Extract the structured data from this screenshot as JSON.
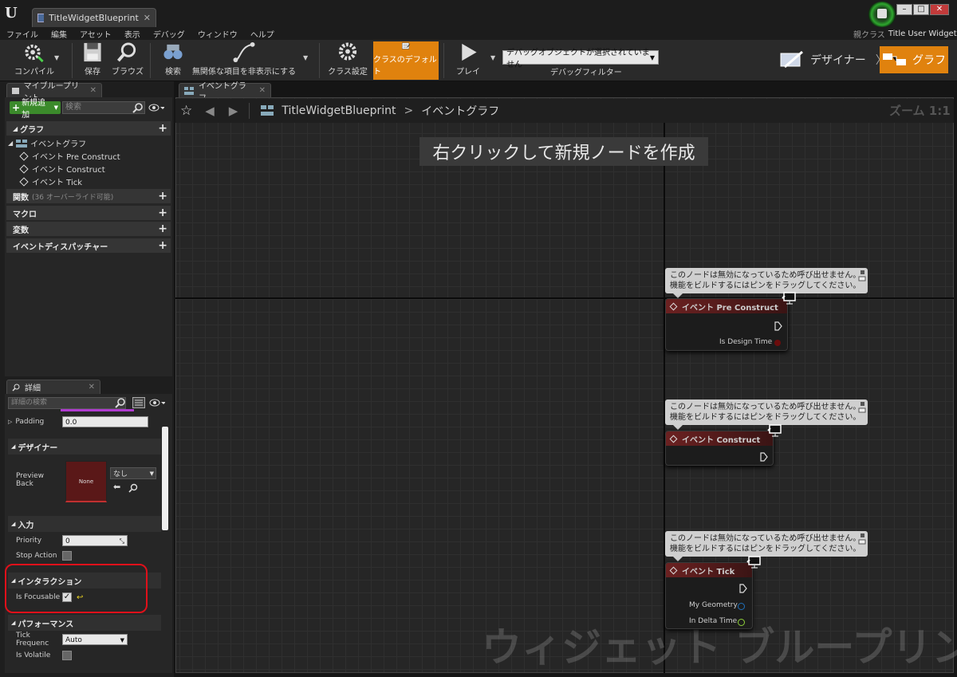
{
  "window": {
    "doc_tab": "TitleWidgetBlueprint",
    "parent_class_label": "親クラス",
    "parent_class_value": "Title User Widget"
  },
  "menu": [
    "ファイル",
    "編集",
    "アセット",
    "表示",
    "デバッグ",
    "ウィンドウ",
    "ヘルプ"
  ],
  "toolbar": {
    "compile": "コンパイル",
    "save": "保存",
    "browse": "ブラウズ",
    "find": "検索",
    "hide_unrelated": "無関係な項目を非表示にする",
    "class_settings": "クラス設定",
    "class_defaults": "クラスのデフォルト",
    "play": "プレイ",
    "debug_select": "デバッグオブジェクトが選択されていません",
    "debug_filter": "デバッグフィルター",
    "designer": "デザイナー",
    "graph": "グラフ"
  },
  "my_blueprint": {
    "tab": "マイブループリント",
    "add_new": "新規追加",
    "search_placeholder": "検索",
    "graphs": "グラフ",
    "event_graph": "イベントグラフ",
    "events": [
      "イベント Pre Construct",
      "イベント Construct",
      "イベント Tick"
    ],
    "functions": "関数",
    "functions_hint": "(36 オーバーライド可能)",
    "macros": "マクロ",
    "variables": "変数",
    "dispatchers": "イベントディスパッチャー"
  },
  "details": {
    "tab": "詳細",
    "search_placeholder": "詳細の検索",
    "padding_label": "Padding",
    "padding_value": "0.0",
    "designer_section": "デザイナー",
    "preview_back_label": "Preview Back",
    "preview_none": "None",
    "preview_select": "なし",
    "input_section": "入力",
    "priority_label": "Priority",
    "priority_value": "0",
    "stop_action_label": "Stop Action",
    "interaction_section": "インタラクション",
    "is_focusable_label": "Is Focusable",
    "is_focusable": true,
    "performance_section": "パフォーマンス",
    "tick_frequency_label": "Tick Frequenc",
    "tick_frequency_value": "Auto",
    "is_volatile_label": "Is Volatile"
  },
  "graph": {
    "tab": "イベントグラフ",
    "breadcrumb_root": "TitleWidgetBlueprint",
    "breadcrumb_current": "イベントグラフ",
    "zoom": "ズーム 1:1",
    "hint": "右クリックして新規ノードを作成",
    "watermark": "ウィジェット ブループリント",
    "comment_line1": "このノードは無効になっているため呼び出せません。",
    "comment_line2": "機能をビルドするにはピンをドラッグしてください。",
    "nodes": [
      {
        "title": "イベント Pre Construct",
        "pins": [
          "Is Design Time"
        ]
      },
      {
        "title": "イベント Construct",
        "pins": []
      },
      {
        "title": "イベント Tick",
        "pins": [
          "My Geometry",
          "In Delta Time"
        ]
      }
    ]
  },
  "colors": {
    "accent_orange": "#e0820e",
    "node_red": "#6b2121",
    "highlight_red": "#e0101a",
    "add_green": "#3b8a2b"
  }
}
